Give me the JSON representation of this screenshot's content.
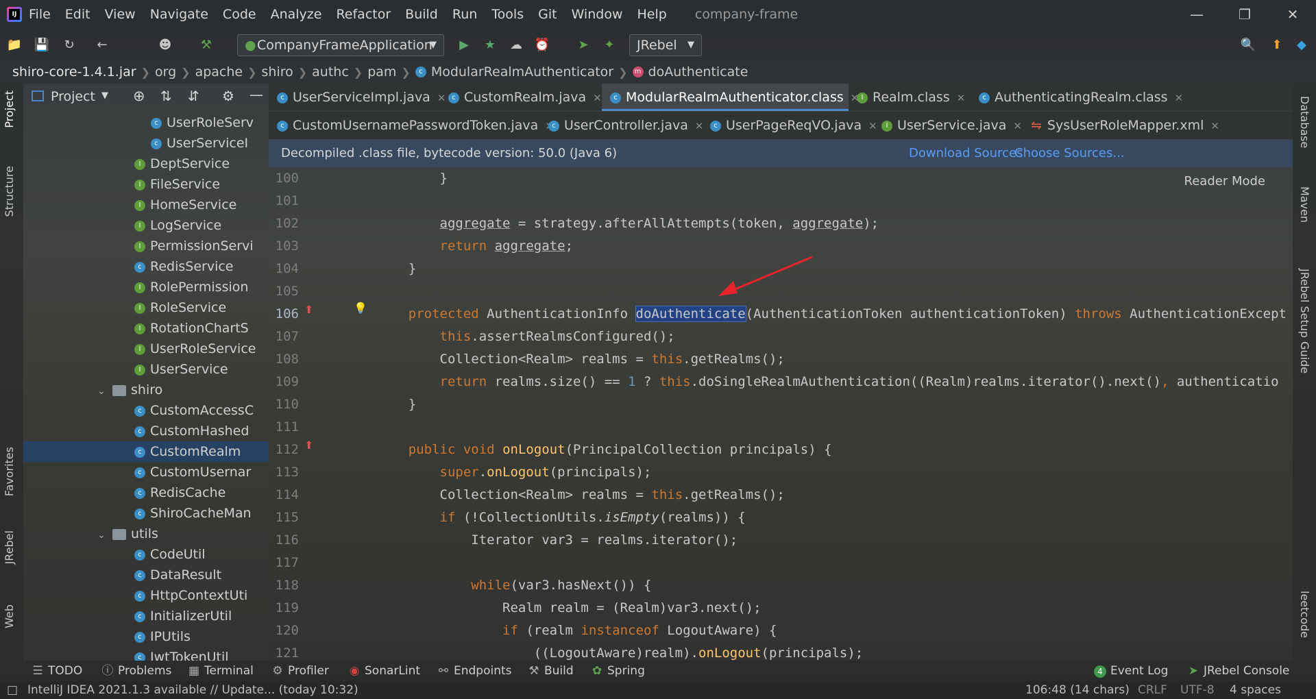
{
  "app": {
    "project_name": "company-frame"
  },
  "menu": [
    "File",
    "Edit",
    "View",
    "Navigate",
    "Code",
    "Analyze",
    "Refactor",
    "Build",
    "Run",
    "Tools",
    "Git",
    "Window",
    "Help"
  ],
  "toolbar": {
    "run_config": "CompanyFrameApplication",
    "jrebel": "JRebel"
  },
  "breadcrumb": [
    "shiro-core-1.4.1.jar",
    "org",
    "apache",
    "shiro",
    "authc",
    "pam",
    "ModularRealmAuthenticator",
    "doAuthenticate"
  ],
  "project_panel": {
    "title": "Project",
    "items": [
      {
        "label": "UserRoleServ",
        "kind": "c"
      },
      {
        "label": "UserServiceI",
        "kind": "c"
      },
      {
        "label": "DeptService",
        "kind": "i"
      },
      {
        "label": "FileService",
        "kind": "i"
      },
      {
        "label": "HomeService",
        "kind": "i"
      },
      {
        "label": "LogService",
        "kind": "i"
      },
      {
        "label": "PermissionServi",
        "kind": "i"
      },
      {
        "label": "RedisService",
        "kind": "c"
      },
      {
        "label": "RolePermission",
        "kind": "i"
      },
      {
        "label": "RoleService",
        "kind": "i"
      },
      {
        "label": "RotationChartS",
        "kind": "i"
      },
      {
        "label": "UserRoleService",
        "kind": "i"
      },
      {
        "label": "UserService",
        "kind": "i"
      },
      {
        "label": "shiro",
        "kind": "folder"
      },
      {
        "label": "CustomAccessC",
        "kind": "c"
      },
      {
        "label": "CustomHashed",
        "kind": "c"
      },
      {
        "label": "CustomRealm",
        "kind": "c"
      },
      {
        "label": "CustomUsernar",
        "kind": "c"
      },
      {
        "label": "RedisCache",
        "kind": "c"
      },
      {
        "label": "ShiroCacheMan",
        "kind": "c"
      },
      {
        "label": "utils",
        "kind": "folder"
      },
      {
        "label": "CodeUtil",
        "kind": "c"
      },
      {
        "label": "DataResult",
        "kind": "c"
      },
      {
        "label": "HttpContextUti",
        "kind": "c"
      },
      {
        "label": "InitializerUtil",
        "kind": "c"
      },
      {
        "label": "IPUtils",
        "kind": "c"
      },
      {
        "label": "JwtTokenUtil",
        "kind": "c"
      }
    ]
  },
  "tabs_row1": [
    "UserServiceImpl.java",
    "CustomRealm.java",
    "ModularRealmAuthenticator.class",
    "Realm.class",
    "AuthenticatingRealm.class"
  ],
  "tabs_row2": [
    "CustomUsernamePasswordToken.java",
    "UserController.java",
    "UserPageReqVO.java",
    "UserService.java",
    "SysUserRoleMapper.xml"
  ],
  "decompiled_bar": {
    "message": "Decompiled .class file, bytecode version: 50.0 (Java 6)",
    "download": "Download Sources",
    "choose": "Choose Sources..."
  },
  "reader_mode": "Reader Mode",
  "code_lines": [
    {
      "n": "100",
      "t": "        }"
    },
    {
      "n": "101",
      "t": ""
    },
    {
      "n": "102",
      "t": "        aggregate = strategy.afterAllAttempts(token, aggregate);"
    },
    {
      "n": "103",
      "t": "        return aggregate;"
    },
    {
      "n": "104",
      "t": "    }"
    },
    {
      "n": "105",
      "t": ""
    },
    {
      "n": "106",
      "t": "    protected AuthenticationInfo doAuthenticate(AuthenticationToken authenticationToken) throws AuthenticationExcept"
    },
    {
      "n": "107",
      "t": "        this.assertRealmsConfigured();"
    },
    {
      "n": "108",
      "t": "        Collection<Realm> realms = this.getRealms();"
    },
    {
      "n": "109",
      "t": "        return realms.size() == 1 ? this.doSingleRealmAuthentication((Realm)realms.iterator().next(), authenticatio"
    },
    {
      "n": "110",
      "t": "    }"
    },
    {
      "n": "111",
      "t": ""
    },
    {
      "n": "112",
      "t": "    public void onLogout(PrincipalCollection principals) {"
    },
    {
      "n": "113",
      "t": "        super.onLogout(principals);"
    },
    {
      "n": "114",
      "t": "        Collection<Realm> realms = this.getRealms();"
    },
    {
      "n": "115",
      "t": "        if (!CollectionUtils.isEmpty(realms)) {"
    },
    {
      "n": "116",
      "t": "            Iterator var3 = realms.iterator();"
    },
    {
      "n": "117",
      "t": ""
    },
    {
      "n": "118",
      "t": "            while(var3.hasNext()) {"
    },
    {
      "n": "119",
      "t": "                Realm realm = (Realm)var3.next();"
    },
    {
      "n": "120",
      "t": "                if (realm instanceof LogoutAware) {"
    },
    {
      "n": "121",
      "t": "                    ((LogoutAware)realm).onLogout(principals);"
    }
  ],
  "left_strip": [
    "Project",
    "Structure",
    "Favorites",
    "JRebel",
    "Web"
  ],
  "right_strip": [
    "Database",
    "Maven",
    "JRebel Setup Guide",
    "leetcode"
  ],
  "bottom_tools": [
    "TODO",
    "Problems",
    "Terminal",
    "Profiler",
    "SonarLint",
    "Endpoints",
    "Build",
    "Spring",
    "Event Log",
    "JRebel Console"
  ],
  "status": {
    "message": "IntelliJ IDEA 2021.1.3 available // Update... (today 10:32)",
    "position": "106:48 (14 chars)",
    "line_sep": "CRLF",
    "encoding": "UTF-8",
    "indent": "4 spaces"
  },
  "colors": {
    "accent": "#4a88c7",
    "keyword": "#cc7832",
    "function": "#ffc66d",
    "number": "#6897bb",
    "selection": "#214283",
    "link": "#589df6"
  }
}
